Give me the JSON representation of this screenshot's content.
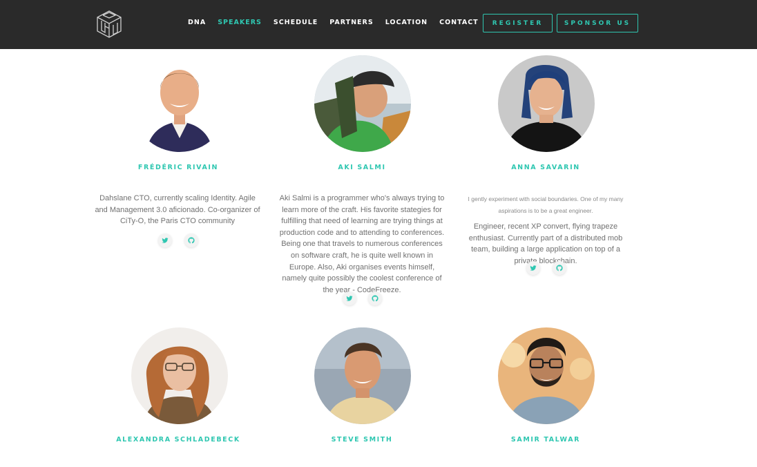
{
  "header": {
    "nav": [
      {
        "label": "DNA",
        "active": false
      },
      {
        "label": "SPEAKERS",
        "active": true
      },
      {
        "label": "SCHEDULE",
        "active": false
      },
      {
        "label": "PARTNERS",
        "active": false
      },
      {
        "label": "LOCATION",
        "active": false
      },
      {
        "label": "CONTACT",
        "active": false
      }
    ],
    "register_label": "REGISTER",
    "sponsor_label": "SPONSOR US",
    "accent_color": "#2fc7b1",
    "background_color": "#2a2a2a"
  },
  "speakers": [
    {
      "name": "FRÉDÉRIC RIVAIN",
      "bio": "Dahslane CTO, currently scaling Identity. Agile and Management 3.0 aficionado. Co-organizer of CiTy-O, the Paris CTO community",
      "socials": [
        "twitter-icon",
        "github-icon"
      ]
    },
    {
      "name": "AKI SALMI",
      "bio": "Aki Salmi is a programmer who's always trying to learn more of the craft. His favorite stategies for fulfilling that need of learning are trying things at production code and to attending to conferences. Being one that travels to numerous conferences on software craft, he is quite well known in Europe. Also, Aki organises events himself, namely quite possibly the coolest conference of the year - CodeFreeze.",
      "socials": [
        "twitter-icon",
        "github-icon"
      ]
    },
    {
      "name": "ANNA SAVARIN",
      "quote": "I gently experiment with social boundaries. One of my many aspirations is to be a great engineer.",
      "bio": "Engineer, recent XP convert, flying trapeze enthusiast. Currently part of a distributed mob team, building a large application on top of a private blockchain.",
      "socials": [
        "twitter-icon",
        "github-icon"
      ]
    },
    {
      "name": "ALEXANDRA SCHLADEBECK"
    },
    {
      "name": "STEVE SMITH"
    },
    {
      "name": "SAMIR TALWAR"
    }
  ]
}
